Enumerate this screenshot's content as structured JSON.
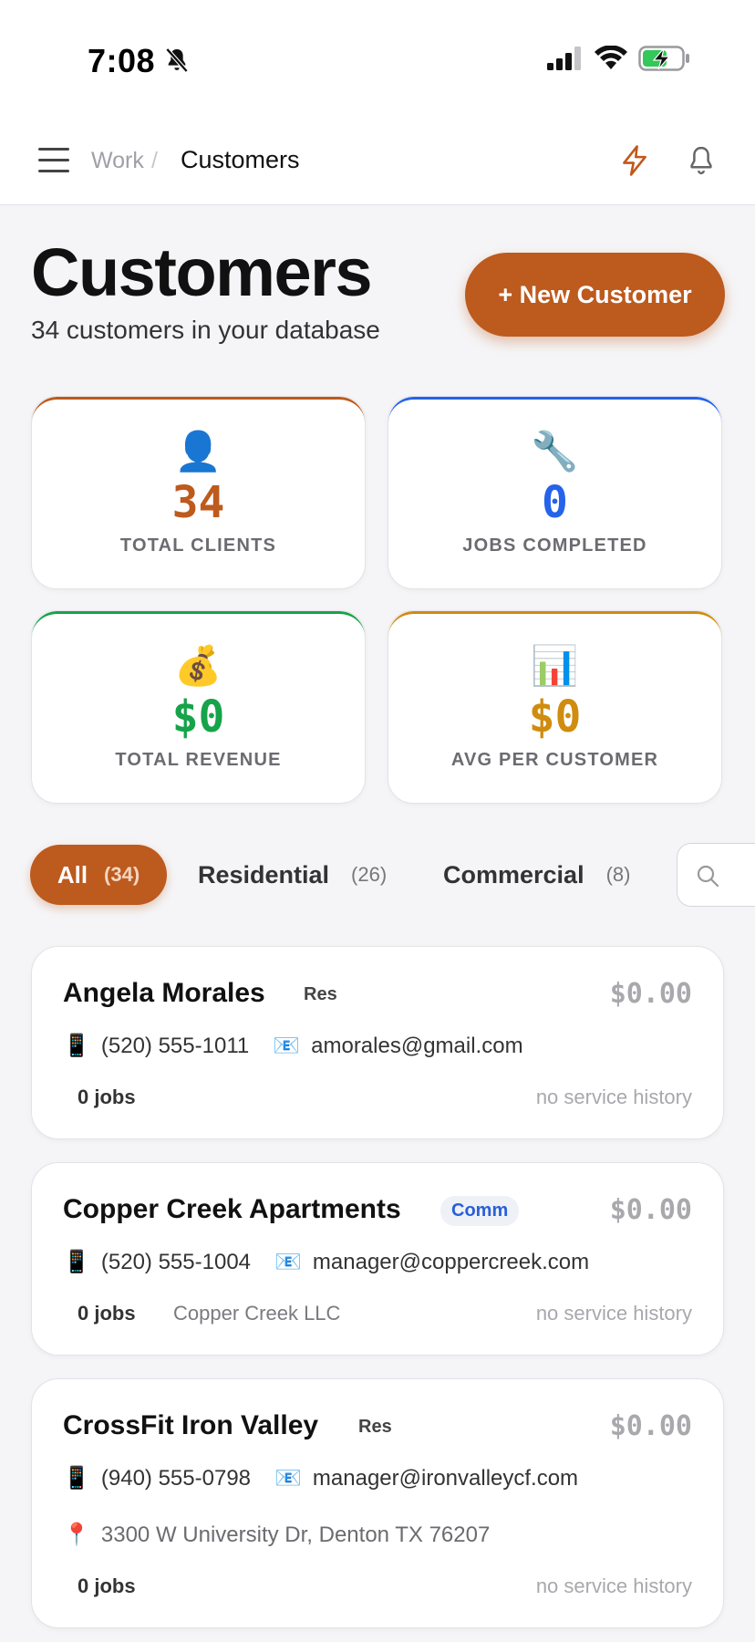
{
  "status_bar": {
    "time": "7:08"
  },
  "nav": {
    "crumb_parent": "Work",
    "crumb_sep": "/",
    "crumb_current": "Customers"
  },
  "header": {
    "title": "Customers",
    "subtitle": "34 customers in your database",
    "new_button": "+ New Customer"
  },
  "stats": [
    {
      "emoji": "👤",
      "value": "34",
      "label": "TOTAL CLIENTS",
      "color": "#bd5a1d"
    },
    {
      "emoji": "🔧",
      "value": "0",
      "label": "JOBS COMPLETED",
      "color": "#2563eb"
    },
    {
      "emoji": "💰",
      "value": "$0",
      "label": "TOTAL REVENUE",
      "color": "#16a34a"
    },
    {
      "emoji": "📊",
      "value": "$0",
      "label": "AVG PER CUSTOMER",
      "color": "#d08c0f"
    }
  ],
  "filters": [
    {
      "label": "All",
      "count": "(34)"
    },
    {
      "label": "Residential",
      "count": "(26)"
    },
    {
      "label": "Commercial",
      "count": "(8)"
    }
  ],
  "customers": [
    {
      "name": "Angela Morales",
      "tag": "Res",
      "amount": "$0.00",
      "phone": "(520) 555-1011",
      "email": "amorales@gmail.com",
      "jobs": "0 jobs",
      "history": "no service history"
    },
    {
      "name": "Copper Creek Apartments",
      "tag": "Comm",
      "amount": "$0.00",
      "phone": "(520) 555-1004",
      "email": "manager@coppercreek.com",
      "jobs": "0 jobs",
      "company": "Copper Creek LLC",
      "history": "no service history"
    },
    {
      "name": "CrossFit Iron Valley",
      "tag": "Res",
      "amount": "$0.00",
      "phone": "(940) 555-0798",
      "email": "manager@ironvalleycf.com",
      "address": "3300 W University Dr, Denton TX 76207",
      "jobs": "0 jobs",
      "history": "no service history"
    }
  ],
  "icons": {
    "phone": "📱",
    "email": "📧",
    "pin": "📍"
  }
}
